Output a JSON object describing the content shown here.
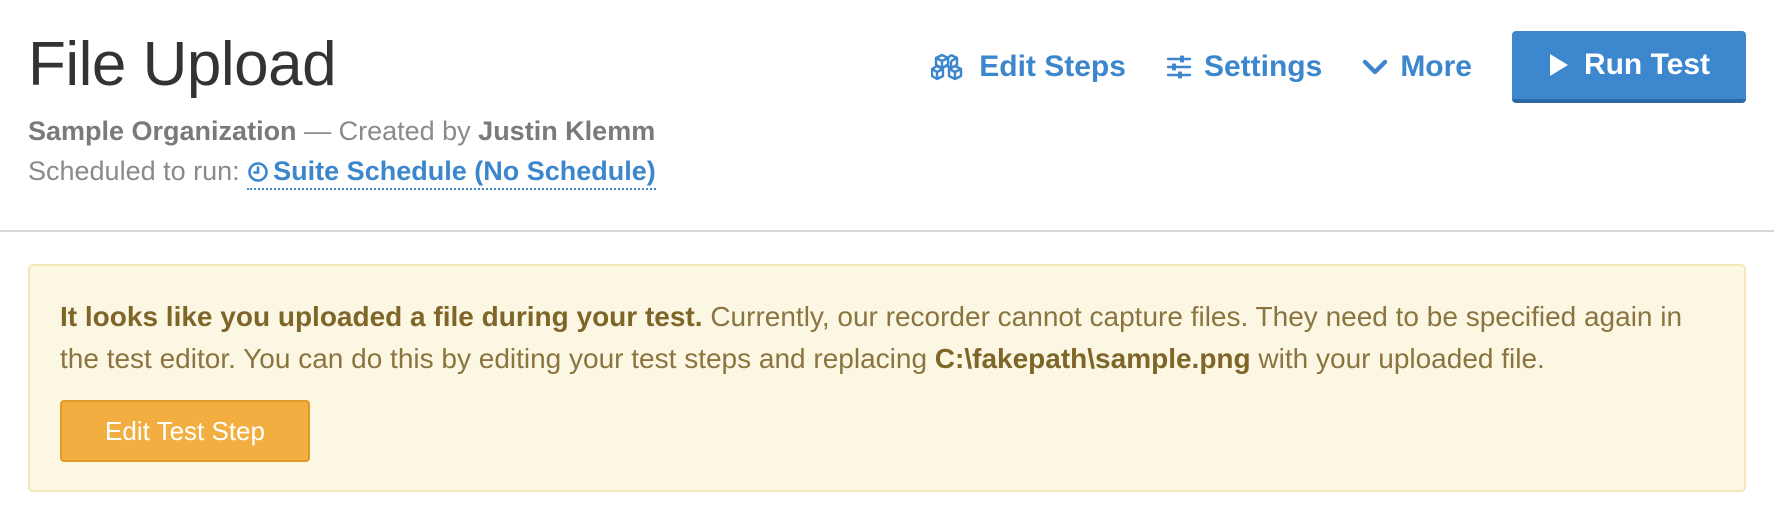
{
  "header": {
    "title": "File Upload",
    "organization": "Sample Organization",
    "created_by_sep": "— Created by",
    "creator": "Justin Klemm",
    "scheduled_label": "Scheduled to run:",
    "schedule_link": "Suite Schedule (No Schedule)"
  },
  "actions": {
    "edit_steps": "Edit Steps",
    "settings": "Settings",
    "more": "More",
    "run_test": "Run Test"
  },
  "alert": {
    "bold_intro": "It looks like you uploaded a file during your test.",
    "body_part1": " Currently, our recorder cannot capture files. They need to be specified again in the test editor. You can do this by editing your test steps and replacing ",
    "file_path": "C:\\fakepath\\sample.png",
    "body_part2": " with your uploaded file.",
    "button_label": "Edit Test Step"
  },
  "icons": {
    "edit_steps": "cubes-icon",
    "settings": "sliders-icon",
    "more": "chevron-down-icon",
    "run_test": "play-icon",
    "schedule": "clock-icon"
  },
  "colors": {
    "link_blue": "#3b86cc",
    "run_button": "#3d87cf",
    "alert_bg": "#fcf7e3",
    "alert_text": "#8a7440",
    "warning_button": "#f2ae40",
    "title_text": "#333333"
  }
}
